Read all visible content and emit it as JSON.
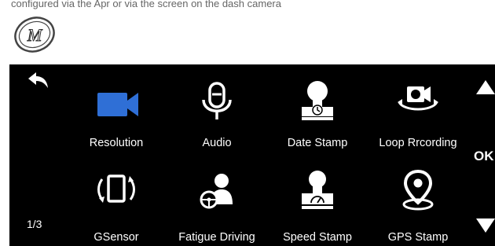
{
  "header_partial_text": "configured via the Apr or via the screen on the dash camera",
  "logo": {
    "letter": "M"
  },
  "screen": {
    "page_indicator": "1/3",
    "items": [
      {
        "label": "Resolution",
        "icon": "video-camera-icon",
        "highlighted": true
      },
      {
        "label": "Audio",
        "icon": "microphone-icon"
      },
      {
        "label": "Date Stamp",
        "icon": "date-stamp-icon"
      },
      {
        "label": "Loop Rrcording",
        "icon": "loop-recording-icon"
      },
      {
        "label": "GSensor",
        "icon": "gsensor-icon"
      },
      {
        "label": "Fatigue Driving",
        "icon": "fatigue-driving-icon"
      },
      {
        "label": "Speed Stamp",
        "icon": "speed-stamp-icon"
      },
      {
        "label": "GPS Stamp",
        "icon": "gps-pin-icon"
      }
    ]
  },
  "side": {
    "ok_label": "OK"
  },
  "colors": {
    "accent": "#2f6fd6",
    "background": "#000000",
    "text": "#ffffff"
  }
}
